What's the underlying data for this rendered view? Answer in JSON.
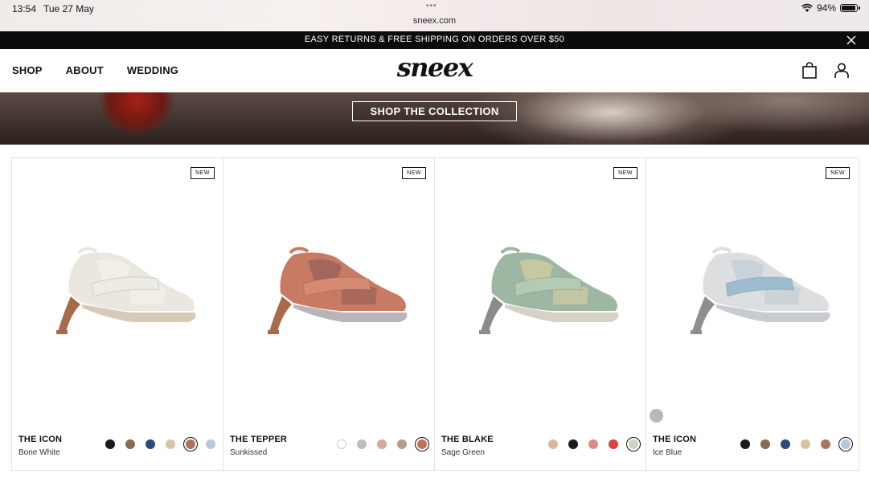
{
  "status": {
    "time": "13:54",
    "date": "Tue 27 May",
    "dots": "•••",
    "url": "sneex.com",
    "battery": "94%"
  },
  "promo": {
    "text": "EASY RETURNS & FREE SHIPPING ON ORDERS OVER $50"
  },
  "nav": {
    "items": [
      "SHOP",
      "ABOUT",
      "WEDDING"
    ]
  },
  "brand": "sneex",
  "hero": {
    "cta": "SHOP THE COLLECTION"
  },
  "products": [
    {
      "badge": "NEW",
      "name": "THE ICON",
      "color": "Bone White",
      "palette": {
        "upper": "#e9e7df",
        "mesh": "#f2f0e6",
        "heel": "#a86a4c",
        "sole": "#d7cbb8",
        "strap": "#ecebe4"
      },
      "swatches": [
        "#1a1a1a",
        "#8a6a50",
        "#2a4a7c",
        "#d8c4a0",
        "#a8765f",
        "#b6c8dc"
      ],
      "selected": 4
    },
    {
      "badge": "NEW",
      "name": "THE TEPPER",
      "color": "Sunkissed",
      "palette": {
        "upper": "#c97a62",
        "mesh": "#a2675a",
        "heel": "#a86a4c",
        "sole": "#b9b4b8",
        "strap": "#d58a72"
      },
      "swatches": [
        "#ffffff",
        "#bdbdbd",
        "#d6aa9c",
        "#b89c8a",
        "#c2705a"
      ],
      "selected": 4
    },
    {
      "badge": "NEW",
      "name": "THE BLAKE",
      "color": "Sage Green",
      "palette": {
        "upper": "#9db7a2",
        "mesh": "#c6c8a2",
        "heel": "#8b8b88",
        "sole": "#d7d2c8",
        "strap": "#b3cbb4"
      },
      "swatches": [
        "#d8b8a0",
        "#1a1a1a",
        "#e08a84",
        "#d8453a",
        "#c8d4c4"
      ],
      "selected": 4
    },
    {
      "badge": "NEW",
      "name": "THE ICON",
      "color": "Ice Blue",
      "palette": {
        "upper": "#dcdedf",
        "mesh": "#c9d2d8",
        "heel": "#8c8f92",
        "sole": "#c8ccd0",
        "strap": "#9dbcd0"
      },
      "swatches": [
        "#1a1a1a",
        "#8a6a50",
        "#2a4a7c",
        "#d8c4a0",
        "#a8765f",
        "#b6c8dc"
      ],
      "selected": 5
    }
  ]
}
